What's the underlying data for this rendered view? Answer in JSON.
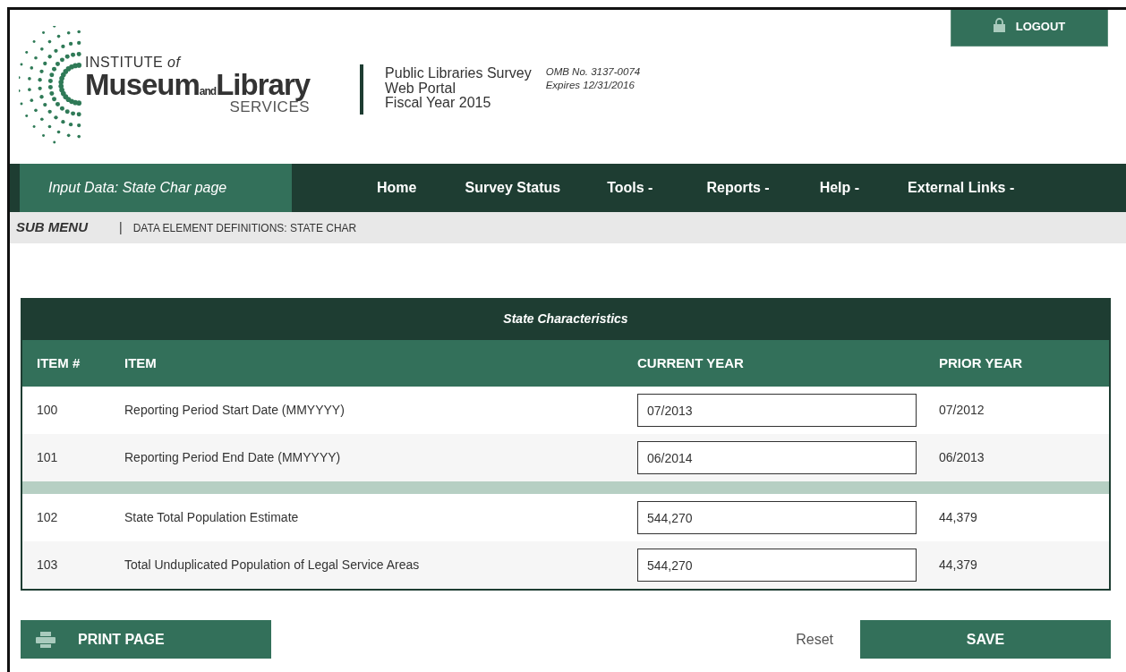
{
  "logout": {
    "label": "LOGOUT"
  },
  "logo": {
    "top": "INSTITUTE",
    "top_small": "of",
    "left": "Museum",
    "mid": "and",
    "right": "Library",
    "bottom": "SERVICES"
  },
  "survey_title": [
    "Public Libraries Survey",
    "Web Portal",
    "Fiscal Year 2015"
  ],
  "omb": [
    "OMB No. 3137-0074",
    "Expires 12/31/2016"
  ],
  "nav": {
    "items": [
      {
        "label": "Input Data: State Char page",
        "selected": true
      },
      {
        "label": "Home",
        "selected": false
      },
      {
        "label": "Survey Status",
        "selected": false
      },
      {
        "label": "Tools -",
        "selected": false
      },
      {
        "label": "Reports -",
        "selected": false
      },
      {
        "label": "Help -",
        "selected": false
      },
      {
        "label": "External Links -",
        "selected": false
      }
    ]
  },
  "sub_menu": {
    "title": "SUB MENU",
    "separator": "|",
    "link": "DATA ELEMENT DEFINITIONS: STATE CHAR"
  },
  "table": {
    "title": "State Characteristics",
    "columns": [
      "ITEM #",
      "ITEM",
      "CURRENT YEAR",
      "PRIOR YEAR"
    ],
    "groups": [
      [
        {
          "item": "100",
          "label": "Reporting Period Start Date (MMYYYY)",
          "current": "07/2013",
          "prior": "07/2012"
        },
        {
          "item": "101",
          "label": "Reporting Period End Date (MMYYYY)",
          "current": "06/2014",
          "prior": "06/2013"
        }
      ],
      [
        {
          "item": "102",
          "label": "State Total Population Estimate",
          "current": "544,270",
          "prior": "44,379"
        },
        {
          "item": "103",
          "label": "Total Unduplicated Population of Legal Service Areas",
          "current": "544,270",
          "prior": "44,379"
        }
      ]
    ]
  },
  "buttons": {
    "print": "PRINT PAGE",
    "reset": "Reset",
    "save": "SAVE"
  }
}
